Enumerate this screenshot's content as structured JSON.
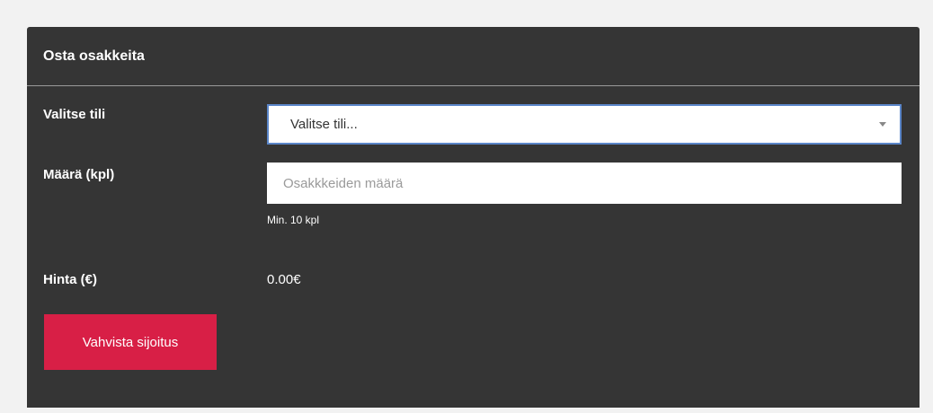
{
  "form": {
    "title": "Osta osakkeita",
    "account": {
      "label": "Valitse tili",
      "selected": "Valitse tili..."
    },
    "amount": {
      "label": "Määrä (kpl)",
      "placeholder": "Osakkkeiden määrä",
      "value": "",
      "help": "Min. 10 kpl"
    },
    "price": {
      "label": "Hinta (€)",
      "value": "0.00€"
    },
    "submit_label": "Vahvista sijoitus"
  },
  "colors": {
    "page_background": "#f2f2f2",
    "panel_background": "#353535",
    "select_focus_border": "#5b86c9",
    "primary_button": "#d81f46"
  },
  "icons": {
    "select_arrow": "caret-down-icon"
  }
}
